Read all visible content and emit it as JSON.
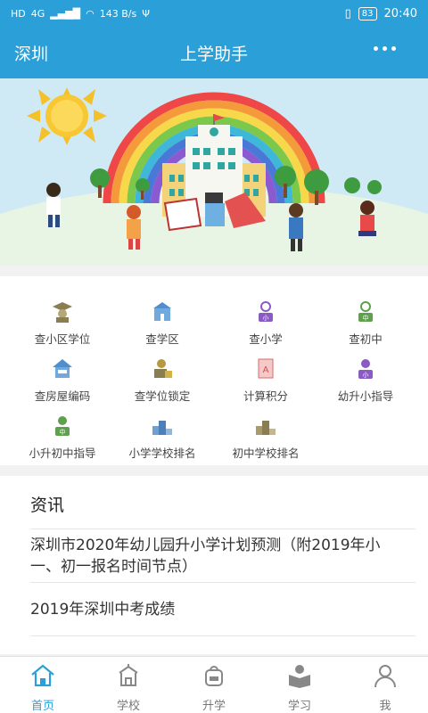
{
  "status": {
    "network": "4G",
    "speed": "143 B/s",
    "battery": "83",
    "time": "20:40"
  },
  "header": {
    "city": "深圳",
    "title": "上学助手"
  },
  "tools": [
    {
      "label": "查小区学位",
      "icon": "graduate-icon"
    },
    {
      "label": "查学区",
      "icon": "school-building-icon"
    },
    {
      "label": "查小学",
      "icon": "primary-student-icon"
    },
    {
      "label": "查初中",
      "icon": "middle-student-icon"
    },
    {
      "label": "查房屋编码",
      "icon": "house-code-icon"
    },
    {
      "label": "查学位锁定",
      "icon": "lock-person-icon"
    },
    {
      "label": "计算积分",
      "icon": "calculator-doc-icon"
    },
    {
      "label": "幼升小指导",
      "icon": "kid-guide-icon"
    },
    {
      "label": "小升初中指导",
      "icon": "middle-guide-icon"
    },
    {
      "label": "小学学校排名",
      "icon": "podium-blue-icon"
    },
    {
      "label": "初中学校排名",
      "icon": "podium-olive-icon"
    }
  ],
  "news": {
    "heading": "资讯",
    "items": [
      "深圳市2020年幼儿园升小学计划预测（附2019年小一、初一报名时间节点）",
      "2019年深圳中考成绩"
    ]
  },
  "tabs": [
    {
      "label": "首页",
      "icon": "home-icon",
      "active": true
    },
    {
      "label": "学校",
      "icon": "school-icon",
      "active": false
    },
    {
      "label": "升学",
      "icon": "bag-icon",
      "active": false
    },
    {
      "label": "学习",
      "icon": "reading-icon",
      "active": false
    },
    {
      "label": "我",
      "icon": "user-icon",
      "active": false
    }
  ]
}
